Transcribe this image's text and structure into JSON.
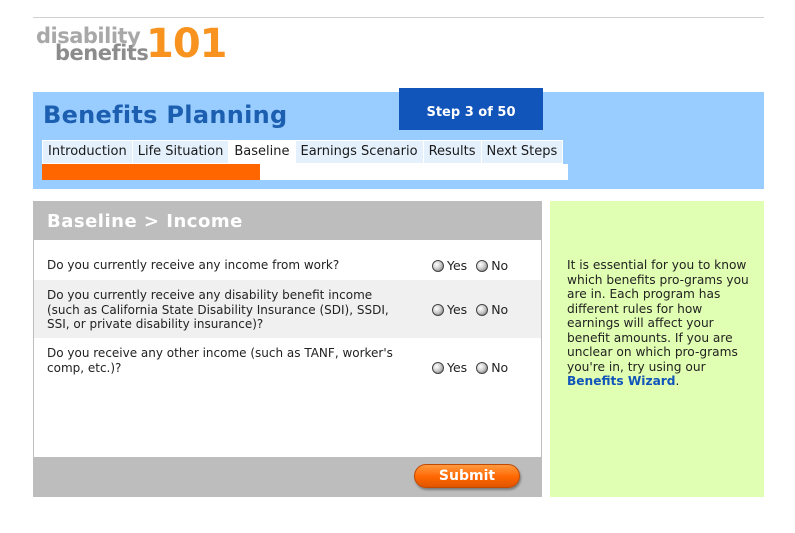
{
  "logo": {
    "word1": "disability",
    "word2": "benefits",
    "number": "101"
  },
  "header": {
    "title": "Benefits Planning",
    "step": "Step 3 of 50",
    "tabs": [
      {
        "label": "Introduction"
      },
      {
        "label": "Life Situation"
      },
      {
        "label": "Baseline"
      },
      {
        "label": "Earnings Scenario"
      },
      {
        "label": "Results"
      },
      {
        "label": "Next Steps"
      }
    ],
    "active_tab": "Baseline",
    "progress": 0.415,
    "progress_color": "#ff6600"
  },
  "panel": {
    "title": "Baseline > Income",
    "questions": [
      {
        "text": "Do you currently receive any income from work?"
      },
      {
        "text": "Do you currently receive any disability benefit income (such as California State Disability Insurance (SDI), SSDI, SSI, or private disability insurance)?"
      },
      {
        "text": "Do you receive any other income (such as TANF, worker's comp, etc.)?"
      }
    ],
    "option_yes": "Yes",
    "option_no": "No",
    "submit_label": "Submit"
  },
  "side_note": {
    "text": "It is essential for you to know which benefits pro-grams you are in. Each program has different rules for how earnings will affect your benefit amounts. If you are unclear on which pro-grams you're in, try using our ",
    "link_label": "Benefits Wizard",
    "suffix": "."
  },
  "colors": {
    "header_bg": "#99ccff",
    "title_blue": "#1c5fb0",
    "step_bg": "#1155bb",
    "side_bg": "#e1ffb2",
    "accent_orange": "#ff6600",
    "logo_orange": "#f7931e"
  }
}
